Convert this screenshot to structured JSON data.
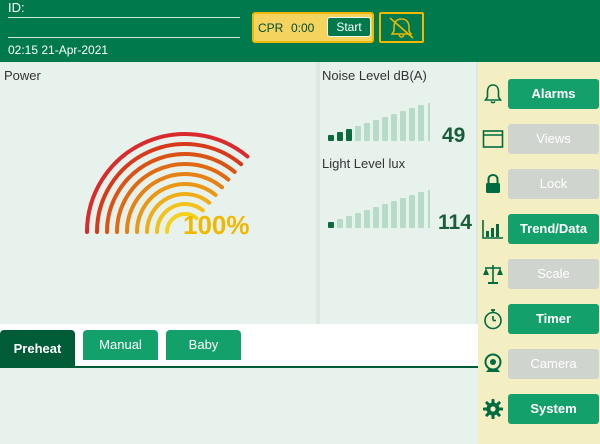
{
  "header": {
    "id_label": "ID:",
    "datetime": "02:15 21-Apr-2021"
  },
  "cpr": {
    "label": "CPR",
    "time": "0:00",
    "start_label": "Start"
  },
  "alarm_silence": {
    "icon": "bell-slash-icon"
  },
  "power": {
    "title": "Power",
    "value_text": "100%",
    "level_percent": 100
  },
  "noise": {
    "title": "Noise Level dB(A)",
    "value": "49",
    "active_bars": 3,
    "total_bars": 11
  },
  "light": {
    "title": "Light Level lux",
    "value": "114",
    "active_bars": 1,
    "total_bars": 11
  },
  "tabs": [
    {
      "label": "Preheat",
      "active": true
    },
    {
      "label": "Manual",
      "active": false
    },
    {
      "label": "Baby",
      "active": false
    }
  ],
  "sidebar": {
    "items": [
      {
        "label": "Alarms",
        "icon": "bell-icon",
        "enabled": true
      },
      {
        "label": "Views",
        "icon": "window-icon",
        "enabled": false
      },
      {
        "label": "Lock",
        "icon": "lock-icon",
        "enabled": false
      },
      {
        "label": "Trend/Data",
        "icon": "bar-chart-icon",
        "enabled": true
      },
      {
        "label": "Scale",
        "icon": "scale-icon",
        "enabled": false
      },
      {
        "label": "Timer",
        "icon": "stopwatch-icon",
        "enabled": true
      },
      {
        "label": "Camera",
        "icon": "webcam-icon",
        "enabled": false
      },
      {
        "label": "System",
        "icon": "gear-icon",
        "enabled": true
      }
    ]
  },
  "colors": {
    "brand_green": "#007a4d",
    "button_green": "#13a06b",
    "dark_green": "#005c36",
    "accent_yellow": "#f0b800",
    "sidebar_bg": "#f3efc2"
  }
}
